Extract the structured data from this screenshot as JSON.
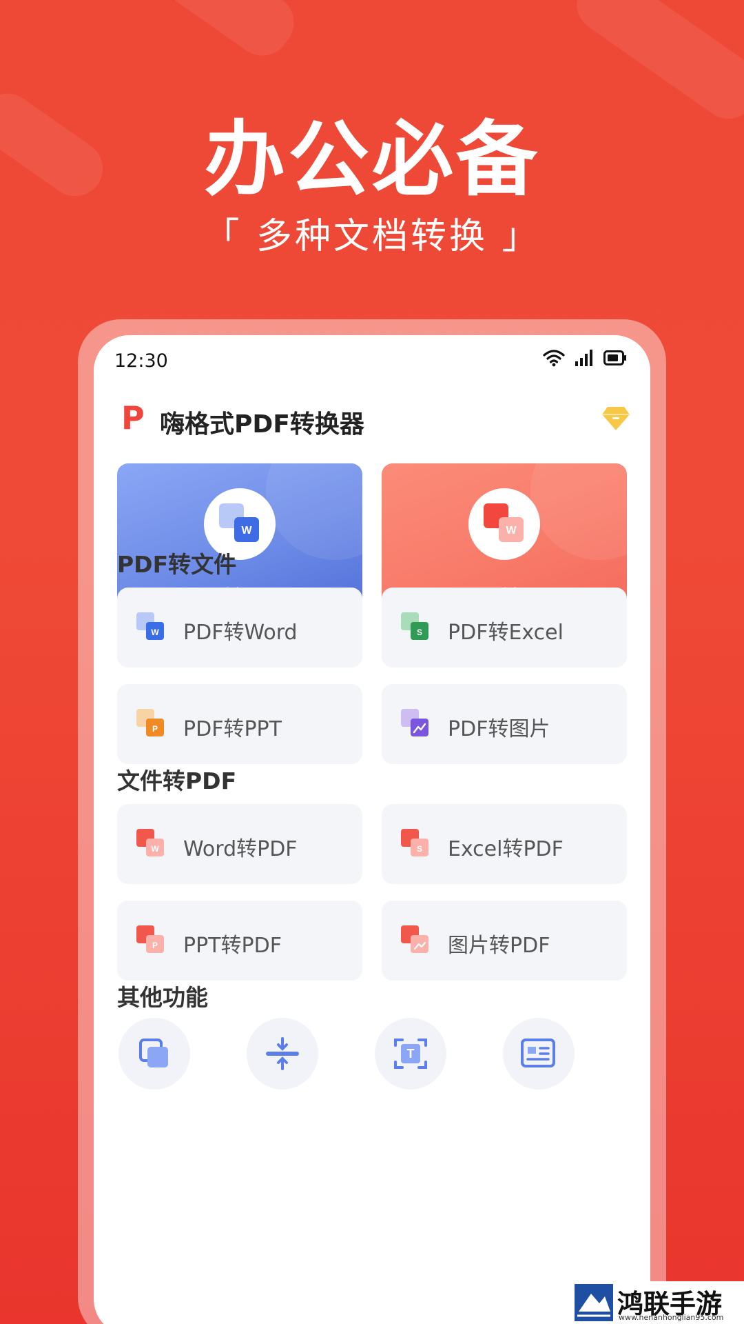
{
  "promo": {
    "title": "办公必备",
    "subtitle": "「 多种文档转换 」"
  },
  "status": {
    "time": "12:30"
  },
  "app": {
    "title": "嗨格式PDF转换器",
    "logo_letter": "P",
    "vip_icon": "diamond-icon"
  },
  "featured": [
    {
      "label": "PDF转Word",
      "icon": "pdf-to-word-icon",
      "color": "#6f8de8"
    },
    {
      "label": "Word转PDF",
      "icon": "word-to-pdf-icon",
      "color": "#f97c6b"
    }
  ],
  "sections": {
    "pdf_to_file": {
      "title": "PDF转文件",
      "items": [
        {
          "label": "PDF转Word",
          "icon": "word-icon",
          "badge": "W",
          "color": "#3a6ee8"
        },
        {
          "label": "PDF转Excel",
          "icon": "excel-icon",
          "badge": "S",
          "color": "#2f9b55"
        },
        {
          "label": "PDF转PPT",
          "icon": "ppt-icon",
          "badge": "P",
          "color": "#f08a24"
        },
        {
          "label": "PDF转图片",
          "icon": "image-icon",
          "badge": "",
          "color": "#7a55de"
        }
      ]
    },
    "file_to_pdf": {
      "title": "文件转PDF",
      "items": [
        {
          "label": "Word转PDF",
          "icon": "word-to-pdf-icon",
          "badge": "W",
          "color": "#f2574c"
        },
        {
          "label": "Excel转PDF",
          "icon": "excel-to-pdf-icon",
          "badge": "S",
          "color": "#f2574c"
        },
        {
          "label": "PPT转PDF",
          "icon": "ppt-to-pdf-icon",
          "badge": "P",
          "color": "#f2574c"
        },
        {
          "label": "图片转PDF",
          "icon": "image-to-pdf-icon",
          "badge": "",
          "color": "#f2574c"
        }
      ]
    },
    "other": {
      "title": "其他功能",
      "icons": [
        "merge-icon",
        "compress-icon",
        "ocr-text-icon",
        "document-icon"
      ]
    }
  },
  "watermark": {
    "text": "鸿联手游网",
    "url": "www.henanhonglian95.com"
  },
  "colors": {
    "background": "#ee4836",
    "accent_red": "#f0453c",
    "blue_card": "#6f8de8",
    "red_card": "#f97c6b"
  }
}
